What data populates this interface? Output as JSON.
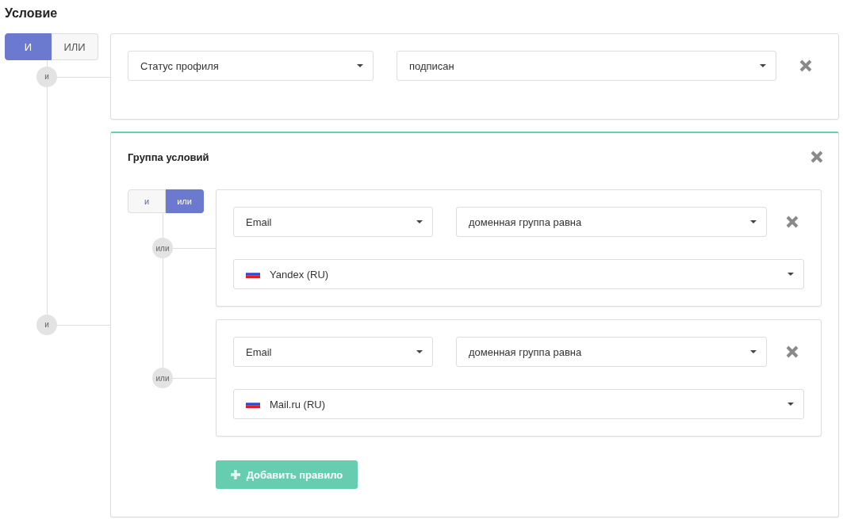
{
  "title": "Условие",
  "root": {
    "operators": [
      {
        "label": "И",
        "selected": true
      },
      {
        "label": "ИЛИ",
        "selected": false
      }
    ],
    "items": [
      {
        "kind": "rule",
        "connector": "и",
        "selects": [
          {
            "kind": "plain",
            "value": "Статус профиля"
          },
          {
            "kind": "plain",
            "value": "подписан"
          }
        ]
      },
      {
        "kind": "group",
        "connector": "и",
        "title": "Группа условий",
        "operators": [
          {
            "label": "и",
            "selected": false
          },
          {
            "label": "или",
            "selected": true
          }
        ],
        "items": [
          {
            "kind": "rule",
            "connector": "или",
            "selects": [
              {
                "kind": "plain",
                "value": "Email"
              },
              {
                "kind": "plain",
                "value": "доменная группа равна"
              },
              {
                "kind": "country",
                "value": "Yandex (RU)"
              }
            ]
          },
          {
            "kind": "rule",
            "connector": "или",
            "selects": [
              {
                "kind": "plain",
                "value": "Email"
              },
              {
                "kind": "plain",
                "value": "доменная группа равна"
              },
              {
                "kind": "country",
                "value": "Mail.ru (RU)"
              }
            ]
          }
        ],
        "add_button": "Добавить правило"
      }
    ]
  }
}
